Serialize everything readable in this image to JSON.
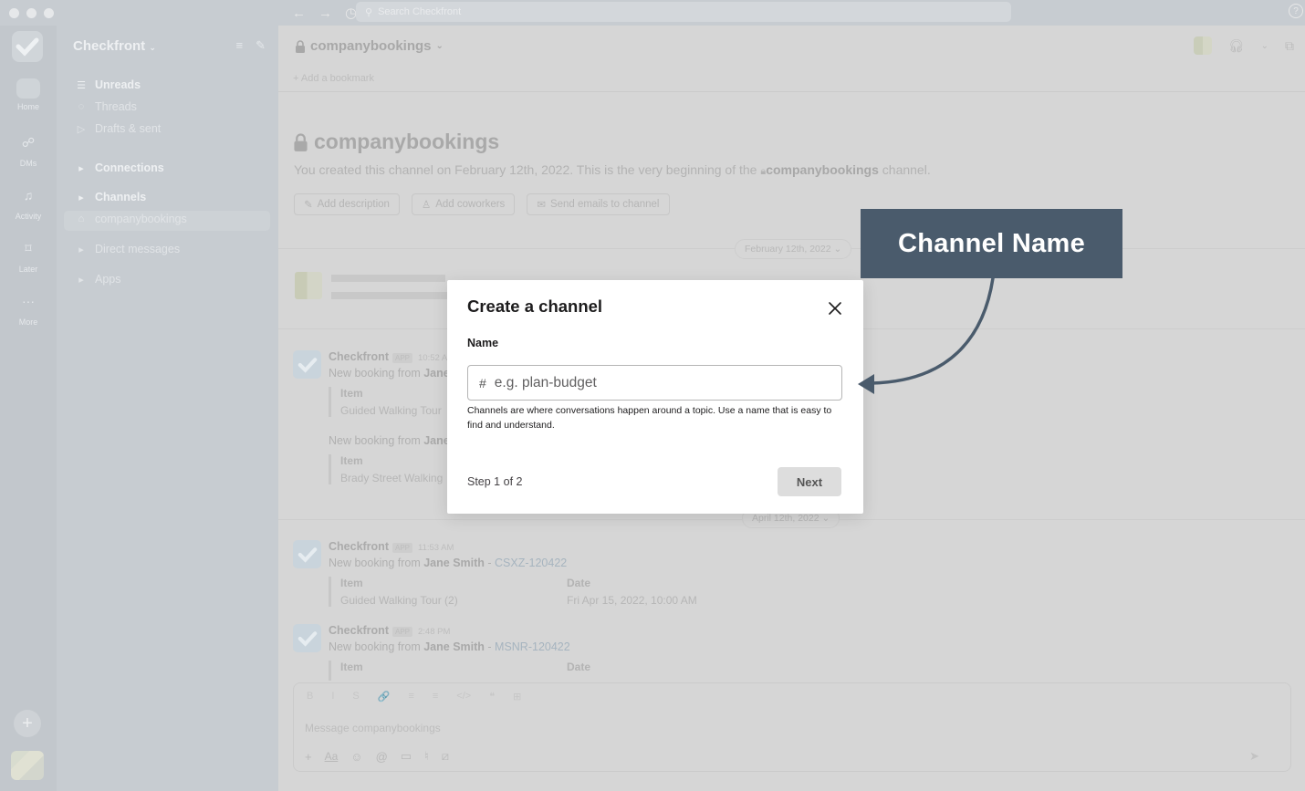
{
  "titlebar": {
    "search_placeholder": "Search Checkfront",
    "help": "?"
  },
  "rail": {
    "items": [
      {
        "label": "Home",
        "icon": "home-icon"
      },
      {
        "label": "DMs",
        "icon": "dms-icon"
      },
      {
        "label": "Activity",
        "icon": "bell-icon"
      },
      {
        "label": "Later",
        "icon": "bookmark-icon"
      },
      {
        "label": "More",
        "icon": "more-icon"
      }
    ]
  },
  "sidebar": {
    "workspace": "Checkfront",
    "items": [
      {
        "label": "Unreads"
      },
      {
        "label": "Threads"
      },
      {
        "label": "Drafts & sent"
      },
      {
        "label": "Connections"
      },
      {
        "label": "Channels"
      },
      {
        "label": "companybookings"
      },
      {
        "label": "Direct messages"
      },
      {
        "label": "Apps"
      }
    ]
  },
  "channel": {
    "name": "companybookings",
    "bookmark": "Add a bookmark",
    "intro_prefix": "You created this channel on February 12th, 2022. This is the very beginning of the",
    "intro_name": "companybookings",
    "intro_suffix": "channel.",
    "chips": [
      "Add description",
      "Add coworkers",
      "Send emails to channel"
    ],
    "date_pill_1": "February 12th, 2022",
    "date_pill_2": "April 12th, 2022"
  },
  "messages": [
    {
      "sender": "Checkfront",
      "badge": "APP",
      "time": "10:52 A",
      "text_prefix": "New booking from",
      "person": "Jane",
      "attach_key": "Item",
      "attach_value": "Guided Walking Tour",
      "text2_prefix": "New booking from",
      "person2": "Jane",
      "attach2_key": "Item",
      "attach2_value": "Brady Street Walking"
    },
    {
      "sender": "Checkfront",
      "badge": "APP",
      "time": "11:53 AM",
      "text_prefix": "New booking from",
      "person": "Jane Smith",
      "code": "CSXZ-120422",
      "attach_key": "Item",
      "attach_value": "Guided Walking Tour (2)",
      "attach_key2": "Date",
      "attach_value2": "Fri Apr 15, 2022, 10:00 AM"
    },
    {
      "sender": "Checkfront",
      "badge": "APP",
      "time": "2:48 PM",
      "text_prefix": "New booking from",
      "person": "Jane Smith",
      "code": "MSNR-120422",
      "attach_key": "Item",
      "attach_key2": "Date"
    }
  ],
  "composer": {
    "placeholder": "Message companybookings",
    "format_icons": [
      "B",
      "I",
      "S",
      "🔗",
      "≡",
      "≡",
      "</>",
      "❝",
      "⊞"
    ]
  },
  "modal": {
    "title": "Create a channel",
    "name_label": "Name",
    "name_placeholder": "e.g. plan-budget",
    "name_value": "",
    "hash": "#",
    "helper": "Channels are where conversations happen around a topic. Use a name that is easy to find and understand.",
    "step": "Step 1 of 2",
    "next_label": "Next"
  },
  "callout": {
    "label": "Channel Name",
    "color": "#4a5b6c"
  }
}
